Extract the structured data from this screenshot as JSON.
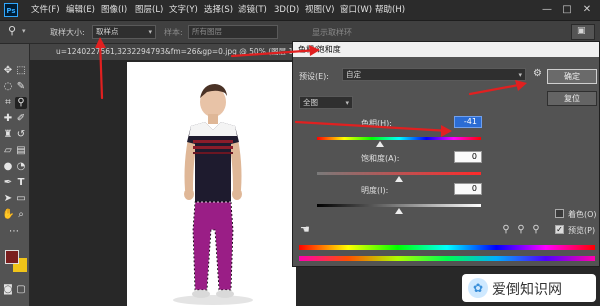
{
  "app": {
    "logo_text": "Ps"
  },
  "menu": [
    "文件(F)",
    "编辑(E)",
    "图像(I)",
    "图层(L)",
    "文字(Y)",
    "选择(S)",
    "滤镜(T)",
    "3D(D)",
    "视图(V)",
    "窗口(W)",
    "帮助(H)"
  ],
  "options_bar": {
    "sample_size_label": "取样大小:",
    "sample_size_value": "取样点",
    "sample_label": "样本:",
    "sample_value": "所有图层",
    "show_ring_label": "显示取样环"
  },
  "document": {
    "tab_title": "u=1240227561,3232294793&fm=26&gp=0.jpg @ 50% (图层 1, RGB/8#)"
  },
  "dialog": {
    "title": "色相/饱和度",
    "preset_label": "预设(E):",
    "preset_value": "自定",
    "channel_value": "全图",
    "hue_label": "色相(H):",
    "hue_value": "-41",
    "saturation_label": "饱和度(A):",
    "saturation_value": "0",
    "lightness_label": "明度(I):",
    "lightness_value": "0",
    "ok_label": "确定",
    "reset_label": "复位",
    "colorize_label": "着色(O)",
    "preview_label": "预览(P)",
    "preview_checked": true,
    "colorize_checked": false
  },
  "colors": {
    "foreground": "#7a1e1e",
    "background": "#f0c419",
    "accent_arrow": "#e02020",
    "pants": "#9a1e86"
  },
  "watermark": {
    "text": "爱倒知识网"
  }
}
